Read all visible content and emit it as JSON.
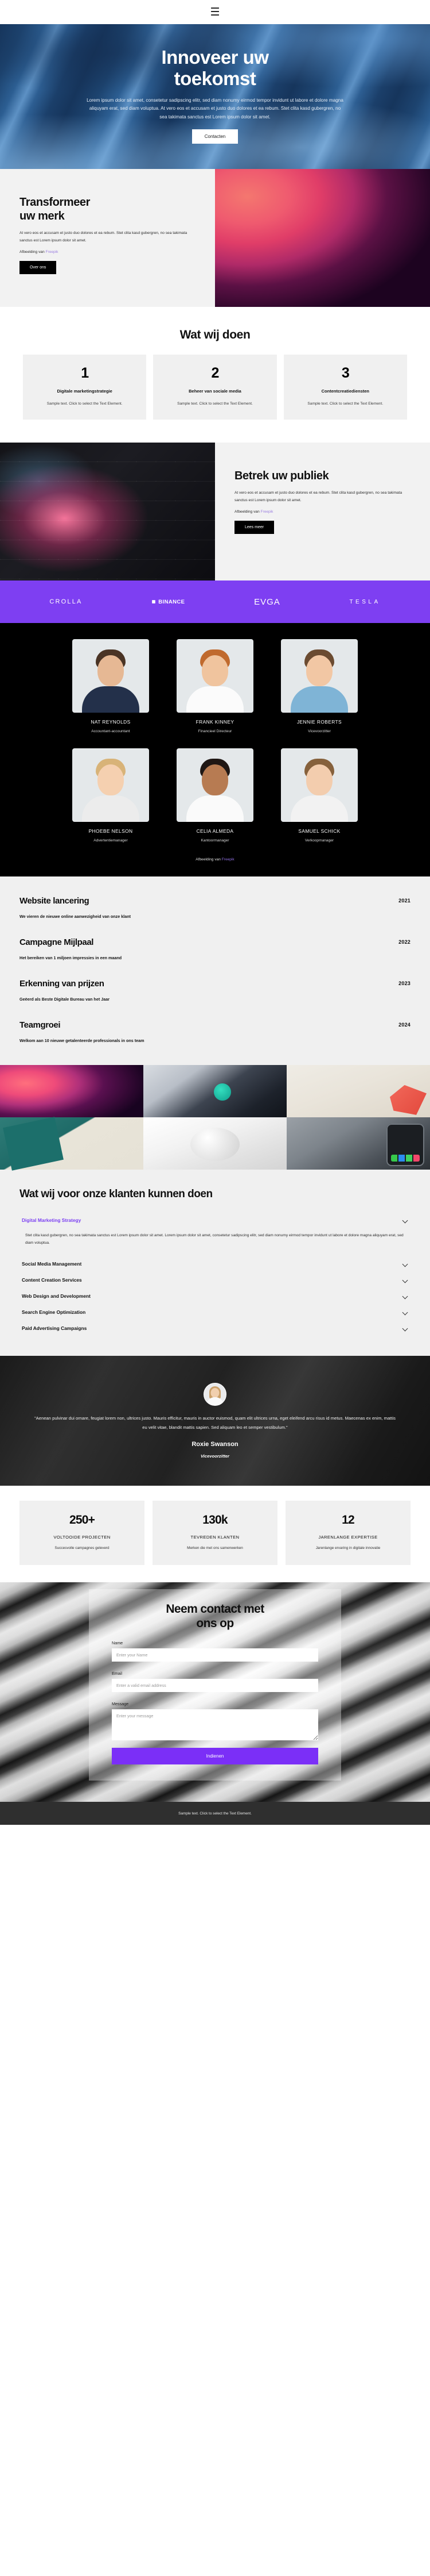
{
  "nav": {
    "menu_icon": "hamburger-menu-icon"
  },
  "hero": {
    "title_line1": "Innoveer uw",
    "title_line2": "toekomst",
    "subtitle": "Lorem ipsum dolor sit amet, consetetur sadipscing elitr, sed diam nonumy eirmod tempor invidunt ut labore et dolore magna aliquyam erat, sed diam voluptua. At vero eos et accusam et justo duo dolores et ea rebum. Stet clita kasd gubergren, no sea takimata sanctus est Lorem ipsum dolor sit amet.",
    "cta_label": "Contacten"
  },
  "brand": {
    "title_line1": "Transformeer",
    "title_line2": "uw merk",
    "body": "At vero eos et accusam et justo duo dolores et ea rebum. Stet clita kasd gubergren, no sea takimata sanctus est Lorem ipsum dolor sit amet.",
    "credit_prefix": "Afbeelding van ",
    "credit_link": "Freepik",
    "cta_label": "Over ons"
  },
  "services": {
    "heading": "Wat wij doen",
    "cards": [
      {
        "number": "1",
        "title": "Digitale marketingstrategie",
        "desc": "Sample text. Click to select the Text Element."
      },
      {
        "number": "2",
        "title": "Beheer van sociale media",
        "desc": "Sample text. Click to select the Text Element."
      },
      {
        "number": "3",
        "title": "Contentcreatiediensten",
        "desc": "Sample text. Click to select the Text Element."
      }
    ]
  },
  "engage": {
    "title": "Betrek uw publiek",
    "body": "At vero eos et accusam et justo duo dolores et ea rebum. Stet clita kasd gubergren, no sea takimata sanctus est Lorem ipsum dolor sit amet.",
    "credit_prefix": "Afbeelding van ",
    "credit_link": "Freepik",
    "cta_label": "Lees meer"
  },
  "logos": [
    {
      "name": "CROLLA",
      "style": "crolla"
    },
    {
      "name": "BINANCE",
      "style": "binance"
    },
    {
      "name": "EVGA",
      "style": "evga"
    },
    {
      "name": "TESLA",
      "style": "tesla"
    }
  ],
  "team": {
    "credit_prefix": "Afbeelding van ",
    "credit_link": "Freepik",
    "members": [
      {
        "name": "NAT REYNOLDS",
        "role": "Accountant-accountant",
        "skin": "#e6b894",
        "hair": "#4a3425",
        "cloth": "#23304a"
      },
      {
        "name": "FRANK KINNEY",
        "role": "Financieel Directeur",
        "skin": "#f0c49e",
        "hair": "#c06a2e",
        "cloth": "#fbfbfb"
      },
      {
        "name": "JENNIE ROBERTS",
        "role": "Vicevoorzitter",
        "skin": "#f2c7a4",
        "hair": "#6b4b31",
        "cloth": "#7fb4d6"
      },
      {
        "name": "PHOEBE NELSON",
        "role": "Advertentiemanager",
        "skin": "#f5d0b0",
        "hair": "#d8b378",
        "cloth": "#ececec"
      },
      {
        "name": "CELIA ALMEDA",
        "role": "Kantoormanager",
        "skin": "#b77b52",
        "hair": "#1f1714",
        "cloth": "#fafafa"
      },
      {
        "name": "SAMUEL SCHICK",
        "role": "Verkoopmanager",
        "skin": "#f3cdae",
        "hair": "#86613c",
        "cloth": "#f2f2f2"
      }
    ]
  },
  "timeline": [
    {
      "title": "Website lancering",
      "desc": "We vieren de nieuwe online aanwezigheid van onze klant",
      "year": "2021"
    },
    {
      "title": "Campagne Mijlpaal",
      "desc": "Het bereiken van 1 miljoen impressies in een maand",
      "year": "2022"
    },
    {
      "title": "Erkenning van prijzen",
      "desc": "Geëerd als Beste Digitale Bureau van het Jaar",
      "year": "2023"
    },
    {
      "title": "Teamgroei",
      "desc": "Welkom aan 10 nieuwe getalenteerde professionals in ons team",
      "year": "2024"
    }
  ],
  "faq": {
    "heading": "Wat wij voor onze klanten kunnen doen",
    "items": [
      {
        "title": "Digital Marketing Strategy",
        "open": true,
        "body": "Stet clita kasd gubergren, no sea takimata sanctus est Lorem ipsum dolor sit amet. Lorem ipsum dolor sit amet, consetetur sadipscing elitr, sed diam nonumy eirmod tempor invidunt ut labore et dolore magna aliquyam erat, sed diam voluptua."
      },
      {
        "title": "Social Media Management",
        "open": false,
        "body": ""
      },
      {
        "title": "Content Creation Services",
        "open": false,
        "body": ""
      },
      {
        "title": "Web Design and Development",
        "open": false,
        "body": ""
      },
      {
        "title": "Search Engine Optimization",
        "open": false,
        "body": ""
      },
      {
        "title": "Paid Advertising Campaigns",
        "open": false,
        "body": ""
      }
    ]
  },
  "testimonial": {
    "quote": "\"Aenean pulvinar dui ornare, feugiat lorem non, ultrices justo. Mauris efficitur, mauris in auctor euismod, quam elit ultrices urna, eget eleifend arcu risus id metus. Maecenas ex enim, mattis eu velit vitae, blandit mattis sapien. Sed aliquam leo et semper vestibulum.\"",
    "name": "Roxie Swanson",
    "role": "Vicevoorzitter"
  },
  "stats": [
    {
      "number": "250+",
      "label": "VOLTOOIDE PROJECTEN",
      "desc": "Succesvolle campagnes geleverd"
    },
    {
      "number": "130k",
      "label": "TEVREDEN KLANTEN",
      "desc": "Merken die met ons samenwerken"
    },
    {
      "number": "12",
      "label": "JARENLANGE EXPERTISE",
      "desc": "Jarenlange ervaring in digitale innovatie"
    }
  ],
  "contact": {
    "title_line1": "Neem contact met",
    "title_line2": "ons op",
    "name_label": "Name",
    "name_placeholder": "Enter your Name",
    "email_label": "Email",
    "email_placeholder": "Enter a valid email address",
    "message_label": "Message",
    "message_placeholder": "Enter your message",
    "submit_label": "Indienen"
  },
  "footer": {
    "text": "Sample text. Click to select the Text Element."
  },
  "colors": {
    "accent": "#7b3ff2",
    "logo_bar": "#7e3ff2",
    "link": "#9b7fe0",
    "dark": "#000000"
  }
}
